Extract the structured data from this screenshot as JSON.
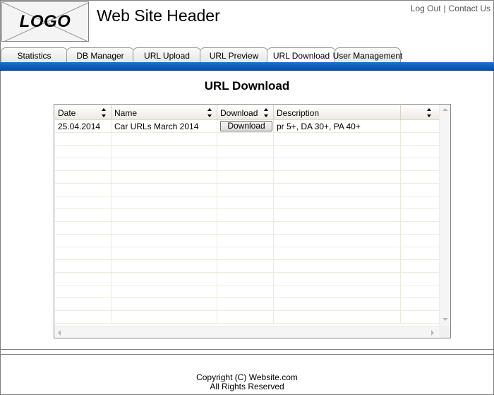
{
  "header": {
    "logo_text": "LOGO",
    "title": "Web Site Header",
    "links": {
      "logout": "Log Out",
      "separator": "|",
      "contact": "Contact Us"
    }
  },
  "tabs": [
    {
      "label": "Statistics",
      "active": false
    },
    {
      "label": "DB Manager",
      "active": false
    },
    {
      "label": "URL Upload",
      "active": false
    },
    {
      "label": "URL Preview",
      "active": false
    },
    {
      "label": "URL Download",
      "active": true
    },
    {
      "label": "User Management",
      "active": false
    }
  ],
  "page": {
    "title": "URL Download"
  },
  "grid": {
    "columns": [
      "Date",
      "Name",
      "Download",
      "Description",
      ""
    ],
    "rows": [
      {
        "date": "25.04.2014",
        "name": "Car URLs March 2014",
        "download_label": "Download",
        "description": "pr 5+, DA 30+, PA 40+"
      }
    ]
  },
  "footer": {
    "line1": "Copyright (C) Website.com",
    "line2": "All Rights Reserved"
  },
  "colors": {
    "tab_bar": "#0a4fa5",
    "border": "#7f7f7f"
  }
}
